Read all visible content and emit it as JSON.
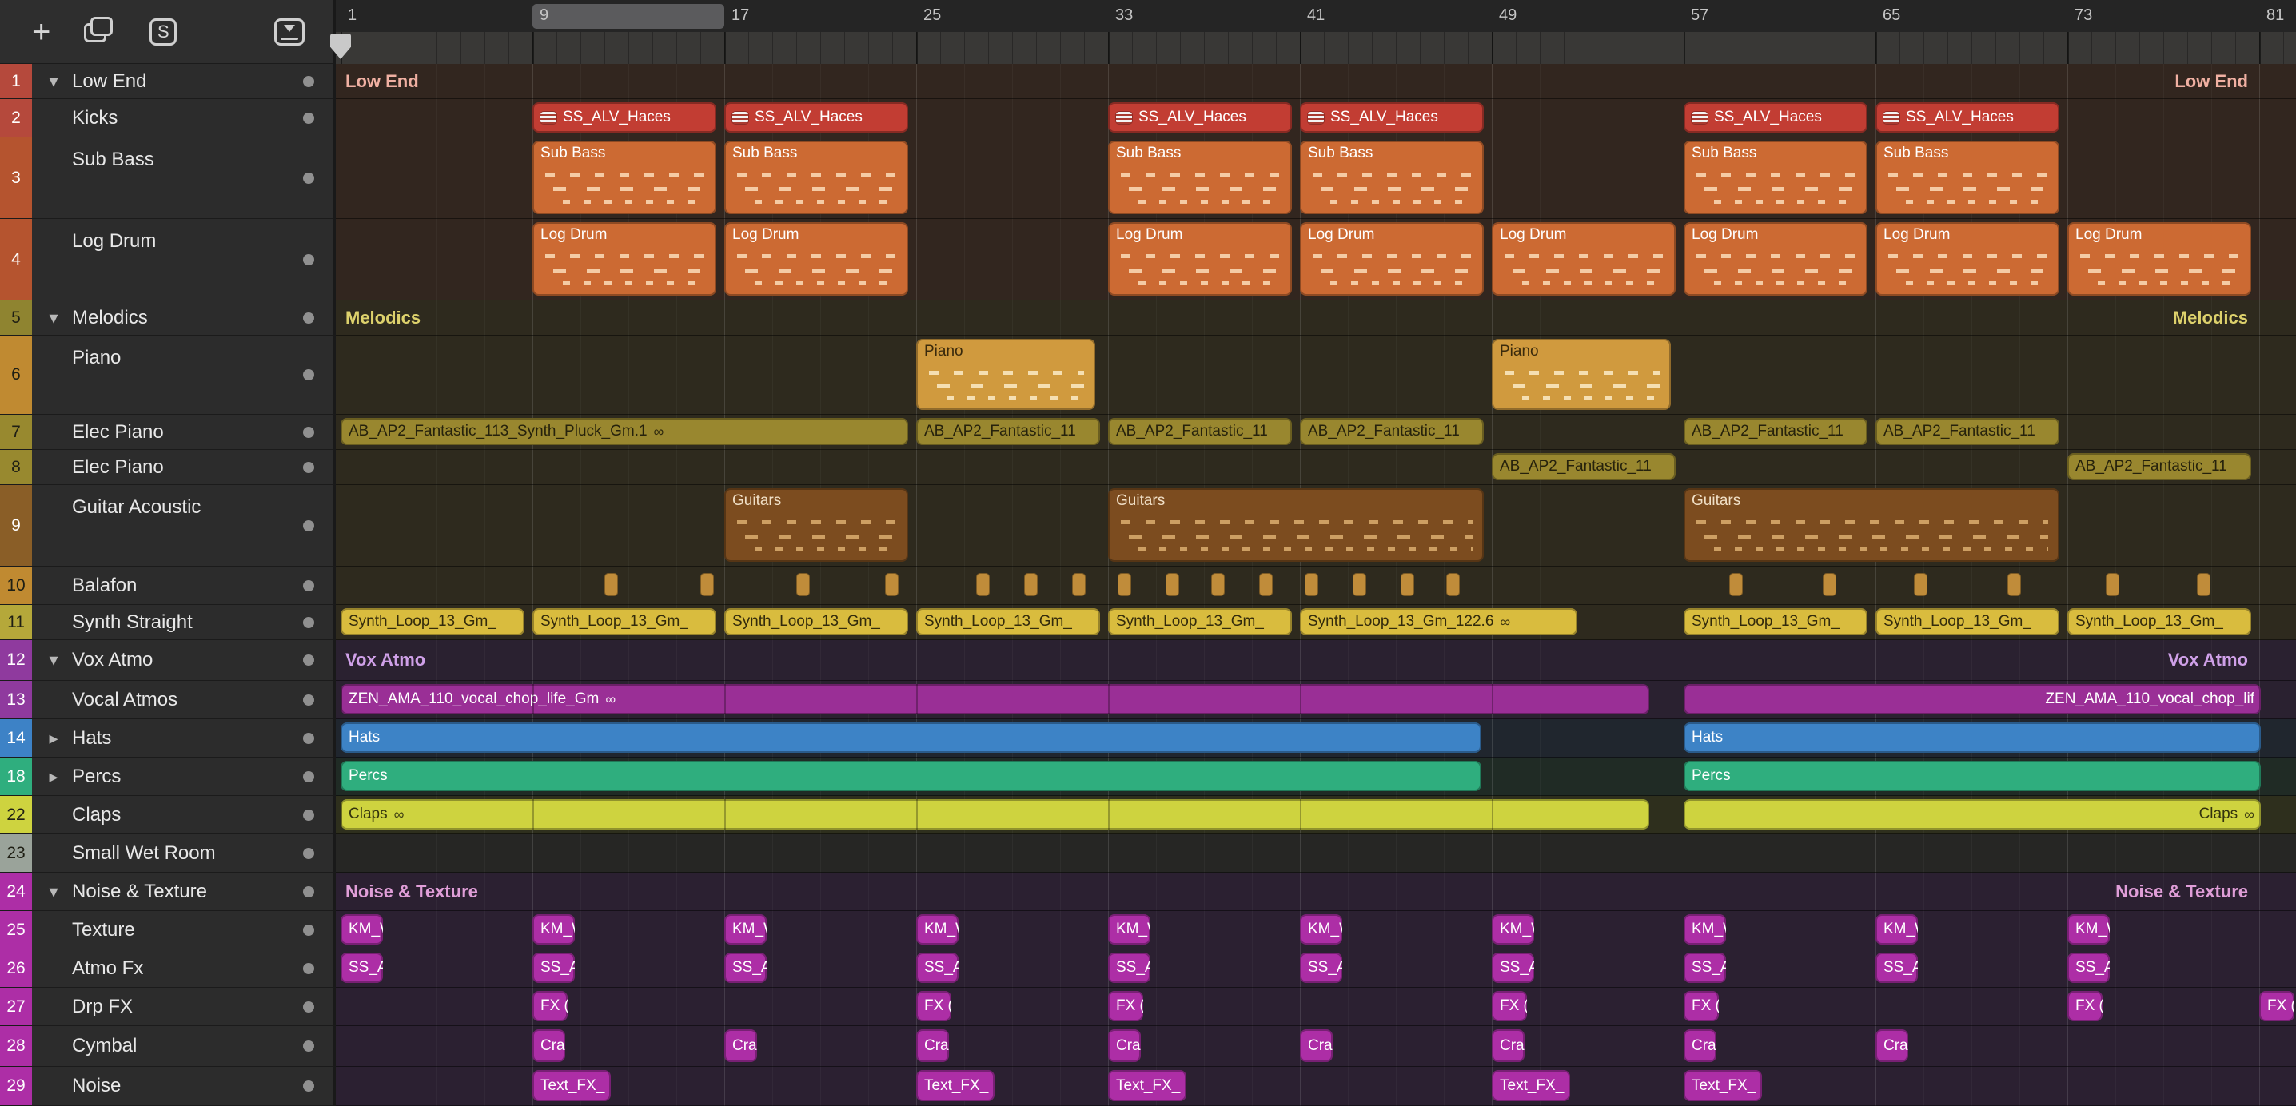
{
  "toolbar": {
    "add_label": "+",
    "s_label": "S"
  },
  "icons": {
    "chevron_expanded": "▾",
    "chevron_collapsed": "▸",
    "loop": "∞"
  },
  "ruler": {
    "bar_labels": [
      "1",
      "9",
      "17",
      "25",
      "33",
      "41",
      "49",
      "57",
      "65",
      "73",
      "81"
    ],
    "first_bar": 1,
    "label_step": 8,
    "cycle_from": 9,
    "cycle_to": 17,
    "playhead_bar": 1
  },
  "palette": {
    "kick": {
      "bg": "#c23d33",
      "text": "#ffffff"
    },
    "orange": {
      "bg": "#cc6a33",
      "text": "#ffffff"
    },
    "amber": {
      "bg": "#d09a3e",
      "text": "#3a2a0c"
    },
    "olive": {
      "bg": "#99872f",
      "text": "#26220c"
    },
    "brown": {
      "bg": "#7c4c1f",
      "text": "#f0dfc6"
    },
    "square": {
      "bg": "#c08c3a",
      "text": "#000000"
    },
    "yellow": {
      "bg": "#d9bc3e",
      "text": "#332b0c"
    },
    "purple": {
      "bg": "#9a2f96",
      "text": "#ffffff"
    },
    "blue": {
      "bg": "#3d83c6",
      "text": "#ffffff"
    },
    "teal": {
      "bg": "#2fae7e",
      "text": "#ffffff"
    },
    "lime": {
      "bg": "#ced33f",
      "text": "#33330e"
    },
    "magenta": {
      "bg": "#ad2ea6",
      "text": "#ffffff"
    }
  },
  "tracks": [
    {
      "num": "1",
      "name": "Low End",
      "group": "expanded",
      "num_color": "#b5493c",
      "section": "lowend",
      "header": true,
      "left_label": "Low End",
      "right_label": "Low End",
      "label_color": "#f0b0a2"
    },
    {
      "num": "2",
      "name": "Kicks",
      "num_color": "#b5493c",
      "section": "lowend",
      "region_style": "kick",
      "region_label": "SS_ALV_Haces",
      "region_icon": true,
      "region_len": 7.8,
      "regions": [
        {
          "s": 9
        },
        {
          "s": 17
        },
        {
          "s": 33
        },
        {
          "s": 41
        },
        {
          "s": 57
        },
        {
          "s": 65
        }
      ]
    },
    {
      "num": "3",
      "name": "Sub Bass",
      "num_color": "#b5542f",
      "section": "lowend",
      "notes": true,
      "region_style": "orange",
      "region_label": "Sub Bass",
      "region_len": 7.8,
      "regions": [
        {
          "s": 9
        },
        {
          "s": 17
        },
        {
          "s": 33
        },
        {
          "s": 41
        },
        {
          "s": 57
        },
        {
          "s": 65
        }
      ]
    },
    {
      "num": "4",
      "name": "Log Drum",
      "num_color": "#b5542f",
      "section": "lowend",
      "notes": true,
      "region_style": "orange",
      "region_label": "Log Drum",
      "region_len": 7.8,
      "regions": [
        {
          "s": 9
        },
        {
          "s": 17
        },
        {
          "s": 33
        },
        {
          "s": 41
        },
        {
          "s": 49
        },
        {
          "s": 57
        },
        {
          "s": 65
        },
        {
          "s": 73
        }
      ]
    },
    {
      "num": "5",
      "name": "Melodics",
      "group": "expanded",
      "num_color": "#8f8430",
      "num_dark": true,
      "section": "melodics",
      "header": true,
      "left_label": "Melodics",
      "right_label": "Melodics",
      "label_color": "#ddd16c"
    },
    {
      "num": "6",
      "name": "Piano",
      "num_color": "#c08a31",
      "num_dark": true,
      "section": "melodics",
      "notes": true,
      "region_style": "amber",
      "region_label": "Piano",
      "region_len": 7.6,
      "regions": [
        {
          "s": 25
        },
        {
          "s": 49
        }
      ]
    },
    {
      "num": "7",
      "name": "Elec Piano",
      "num_color": "#98892f",
      "num_dark": true,
      "section": "melodics",
      "region_style": "olive",
      "region_label": "AB_AP2_Fantastic_11",
      "region_len": 7.8,
      "regions": [
        {
          "s": 1,
          "l": 23.8,
          "label": "AB_AP2_Fantastic_113_Synth_Pluck_Gm.1",
          "loop": true
        },
        {
          "s": 25
        },
        {
          "s": 33
        },
        {
          "s": 41
        },
        {
          "s": 57
        },
        {
          "s": 65
        }
      ]
    },
    {
      "num": "8",
      "name": "Elec Piano",
      "num_color": "#98892f",
      "num_dark": true,
      "section": "melodics",
      "region_style": "olive",
      "region_label": "AB_AP2_Fantastic_11",
      "region_len": 7.8,
      "regions": [
        {
          "s": 49
        },
        {
          "s": 73
        }
      ]
    },
    {
      "num": "9",
      "name": "Guitar Acoustic",
      "num_color": "#8a5e27",
      "section": "melodics",
      "notes": true,
      "region_style": "brown",
      "region_label": "Guitars",
      "region_len": 7.8,
      "regions": [
        {
          "s": 17
        },
        {
          "s": 33,
          "l": 15.8
        },
        {
          "s": 57,
          "l": 15.8
        }
      ]
    },
    {
      "num": "10",
      "name": "Balafon",
      "num_color": "#c08a31",
      "num_dark": true,
      "section": "melodics",
      "region_style": "square",
      "region_len": 0.55,
      "regions": [
        {
          "s": 12
        },
        {
          "s": 16
        },
        {
          "s": 20
        },
        {
          "s": 23.7
        },
        {
          "s": 27.5
        },
        {
          "s": 29.5
        },
        {
          "s": 31.5
        },
        {
          "s": 33.4
        },
        {
          "s": 35.4
        },
        {
          "s": 37.3
        },
        {
          "s": 39.3
        },
        {
          "s": 41.2
        },
        {
          "s": 43.2
        },
        {
          "s": 45.2
        },
        {
          "s": 47.1
        },
        {
          "s": 58.9
        },
        {
          "s": 62.8
        },
        {
          "s": 66.6
        },
        {
          "s": 70.5
        },
        {
          "s": 74.6
        },
        {
          "s": 78.4
        }
      ]
    },
    {
      "num": "11",
      "name": "Synth Straight",
      "num_color": "#b5a83a",
      "num_dark": true,
      "section": "melodics",
      "region_style": "yellow",
      "region_label": "Synth_Loop_13_Gm_",
      "region_len": 7.8,
      "regions": [
        {
          "s": 1
        },
        {
          "s": 9
        },
        {
          "s": 17
        },
        {
          "s": 25
        },
        {
          "s": 33
        },
        {
          "s": 41,
          "l": 11.7,
          "label": "Synth_Loop_13_Gm_122.6",
          "loop": true
        },
        {
          "s": 57
        },
        {
          "s": 65
        },
        {
          "s": 73
        }
      ]
    },
    {
      "num": "12",
      "name": "Vox Atmo",
      "group": "expanded",
      "num_color": "#8f3a9e",
      "section": "voxatmo",
      "header": true,
      "left_label": "Vox Atmo",
      "right_label": "Vox Atmo",
      "label_color": "#cfa0e8"
    },
    {
      "num": "13",
      "name": "Vocal Atmos",
      "num_color": "#8f3a9e",
      "section": "voxatmo",
      "region_style": "purple",
      "region_len": 7.8,
      "regions": [
        {
          "s": 1,
          "l": 54.7,
          "label": "ZEN_AMA_110_vocal_chop_life_Gm",
          "loop": true,
          "marks": true
        },
        {
          "s": 57,
          "l": 24.2,
          "label": "ZEN_AMA_110_vocal_chop_lif",
          "right": true
        }
      ]
    },
    {
      "num": "14",
      "name": "Hats",
      "group": "collapsed",
      "num_color": "#3d82c6",
      "section": "hats",
      "region_style": "blue",
      "region_label": "Hats",
      "regions": [
        {
          "s": 1,
          "l": 47.7
        },
        {
          "s": 57,
          "l": 24.2
        }
      ]
    },
    {
      "num": "18",
      "name": "Percs",
      "group": "collapsed",
      "num_color": "#2fae7e",
      "section": "percs",
      "region_style": "teal",
      "region_label": "Percs",
      "regions": [
        {
          "s": 1,
          "l": 47.7
        },
        {
          "s": 57,
          "l": 24.2
        }
      ]
    },
    {
      "num": "22",
      "name": "Claps",
      "num_color": "#ced33f",
      "num_dark": true,
      "section": "claps",
      "region_style": "lime",
      "region_label": "Claps",
      "regions": [
        {
          "s": 1,
          "l": 54.7,
          "loop": true,
          "marks": true
        },
        {
          "s": 57,
          "l": 24.2,
          "loop": true,
          "right": true
        }
      ]
    },
    {
      "num": "23",
      "name": "Small Wet Room",
      "num_color": "#9aa39a",
      "num_dark": true,
      "section": "room",
      "regions": []
    },
    {
      "num": "24",
      "name": "Noise & Texture",
      "group": "expanded",
      "num_color": "#ad2ea6",
      "section": "noise",
      "header": true,
      "left_label": "Noise & Texture",
      "right_label": "Noise & Texture",
      "label_color": "#e09ed8"
    },
    {
      "num": "25",
      "name": "Texture",
      "num_color": "#ad2ea6",
      "section": "noise",
      "region_style": "magenta",
      "region_label": "KM_W",
      "region_len": 1.9,
      "regions": [
        {
          "s": 1
        },
        {
          "s": 9
        },
        {
          "s": 17
        },
        {
          "s": 25
        },
        {
          "s": 33
        },
        {
          "s": 41
        },
        {
          "s": 49
        },
        {
          "s": 57
        },
        {
          "s": 65
        },
        {
          "s": 73
        }
      ]
    },
    {
      "num": "26",
      "name": "Atmo Fx",
      "num_color": "#ad2ea6",
      "section": "noise",
      "region_style": "magenta",
      "region_label": "SS_AL",
      "region_len": 1.9,
      "regions": [
        {
          "s": 1
        },
        {
          "s": 9
        },
        {
          "s": 17
        },
        {
          "s": 25
        },
        {
          "s": 33
        },
        {
          "s": 41
        },
        {
          "s": 49
        },
        {
          "s": 57
        },
        {
          "s": 65
        },
        {
          "s": 73
        }
      ]
    },
    {
      "num": "27",
      "name": "Drp FX",
      "num_color": "#ad2ea6",
      "section": "noise",
      "region_style": "magenta",
      "region_label": "FX (",
      "region_len": 1.6,
      "regions": [
        {
          "s": 9
        },
        {
          "s": 25
        },
        {
          "s": 33
        },
        {
          "s": 49
        },
        {
          "s": 57
        },
        {
          "s": 73
        },
        {
          "s": 81
        }
      ]
    },
    {
      "num": "28",
      "name": "Cymbal",
      "num_color": "#ad2ea6",
      "section": "noise",
      "region_style": "magenta",
      "region_label": "Cra",
      "region_len": 1.5,
      "regions": [
        {
          "s": 9
        },
        {
          "s": 17
        },
        {
          "s": 25
        },
        {
          "s": 33
        },
        {
          "s": 41
        },
        {
          "s": 49
        },
        {
          "s": 57
        },
        {
          "s": 65
        }
      ]
    },
    {
      "num": "29",
      "name": "Noise",
      "num_color": "#ad2ea6",
      "section": "noise",
      "region_style": "magenta",
      "region_label": "Text_FX_",
      "region_len": 3.4,
      "regions": [
        {
          "s": 9
        },
        {
          "s": 25
        },
        {
          "s": 33
        },
        {
          "s": 49
        },
        {
          "s": 57
        }
      ]
    }
  ]
}
